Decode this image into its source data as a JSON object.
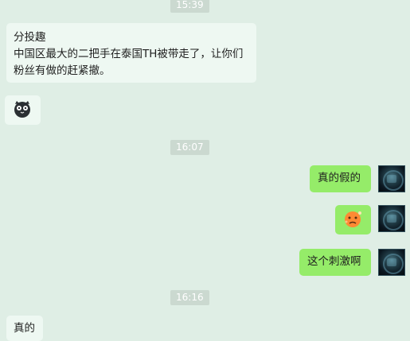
{
  "chat": {
    "times": [
      {
        "label": "15:39"
      },
      {
        "label": "16:07"
      },
      {
        "label": "16:16"
      }
    ],
    "messages": {
      "first_incoming": {
        "line1": "分投趣",
        "line2": "中国区最大的二把手在泰国TH被带走了，让你们",
        "line3": "粉丝有做的赶紧撤。"
      },
      "outgoing_1": "真的假的",
      "outgoing_3": "这个刺激啊",
      "last_incoming": "真的"
    },
    "stickers": {
      "incoming_owl": "owl-face-icon",
      "outgoing_face": "orange-face-emoji-icon"
    },
    "colors": {
      "background": "#dfeee5",
      "incoming_bubble": "#eef8f2",
      "outgoing_bubble": "#95ec69",
      "time_chip": "#cbd9d0"
    }
  }
}
